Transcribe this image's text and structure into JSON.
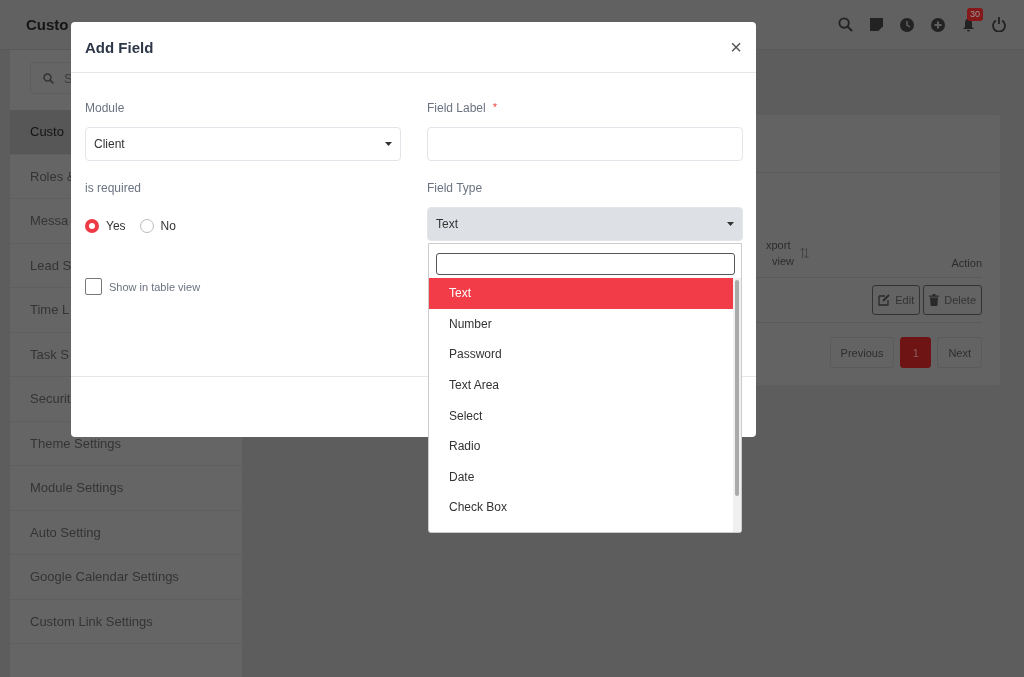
{
  "header": {
    "title": "Custo",
    "notification_count": "30"
  },
  "sidebar": {
    "search_placeholder": "S",
    "items": [
      {
        "label": "Custo",
        "selected": true
      },
      {
        "label": "Roles &",
        "selected": false
      },
      {
        "label": "Messa",
        "selected": false
      },
      {
        "label": "Lead S",
        "selected": false
      },
      {
        "label": "Time L",
        "selected": false
      },
      {
        "label": "Task S",
        "selected": false
      },
      {
        "label": "Securit",
        "selected": false
      },
      {
        "label": "Theme Settings",
        "selected": false
      },
      {
        "label": "Module Settings",
        "selected": false
      },
      {
        "label": "Auto Setting",
        "selected": false
      },
      {
        "label": "Google Calendar Settings",
        "selected": false
      },
      {
        "label": "Custom Link Settings",
        "selected": false
      }
    ]
  },
  "table": {
    "column_1": [
      "xport",
      "view"
    ],
    "column_2": "Action",
    "rows": [
      {
        "actions": [
          "Edit",
          "Delete"
        ]
      }
    ]
  },
  "pagination": {
    "previous": "Previous",
    "pages": [
      {
        "label": "1",
        "selected": true
      }
    ],
    "next": "Next"
  },
  "modal": {
    "title": "Add Field",
    "close": "×",
    "module": {
      "label": "Module",
      "value": "Client"
    },
    "field_label": {
      "label": "Field Label",
      "required_mark": "*"
    },
    "is_required": {
      "label": "is required",
      "options": [
        {
          "label": "Yes",
          "selected": true
        },
        {
          "label": "No",
          "selected": false
        }
      ]
    },
    "show_in_table": {
      "label": "Show in table view",
      "checked": false
    },
    "field_type": {
      "label": "Field Type",
      "value": "Text",
      "open": true,
      "options": [
        {
          "label": "Text",
          "selected": true
        },
        {
          "label": "Number",
          "selected": false
        },
        {
          "label": "Password",
          "selected": false
        },
        {
          "label": "Text Area",
          "selected": false
        },
        {
          "label": "Select",
          "selected": false
        },
        {
          "label": "Radio",
          "selected": false
        },
        {
          "label": "Date",
          "selected": false
        },
        {
          "label": "Check Box",
          "selected": false
        }
      ]
    }
  }
}
